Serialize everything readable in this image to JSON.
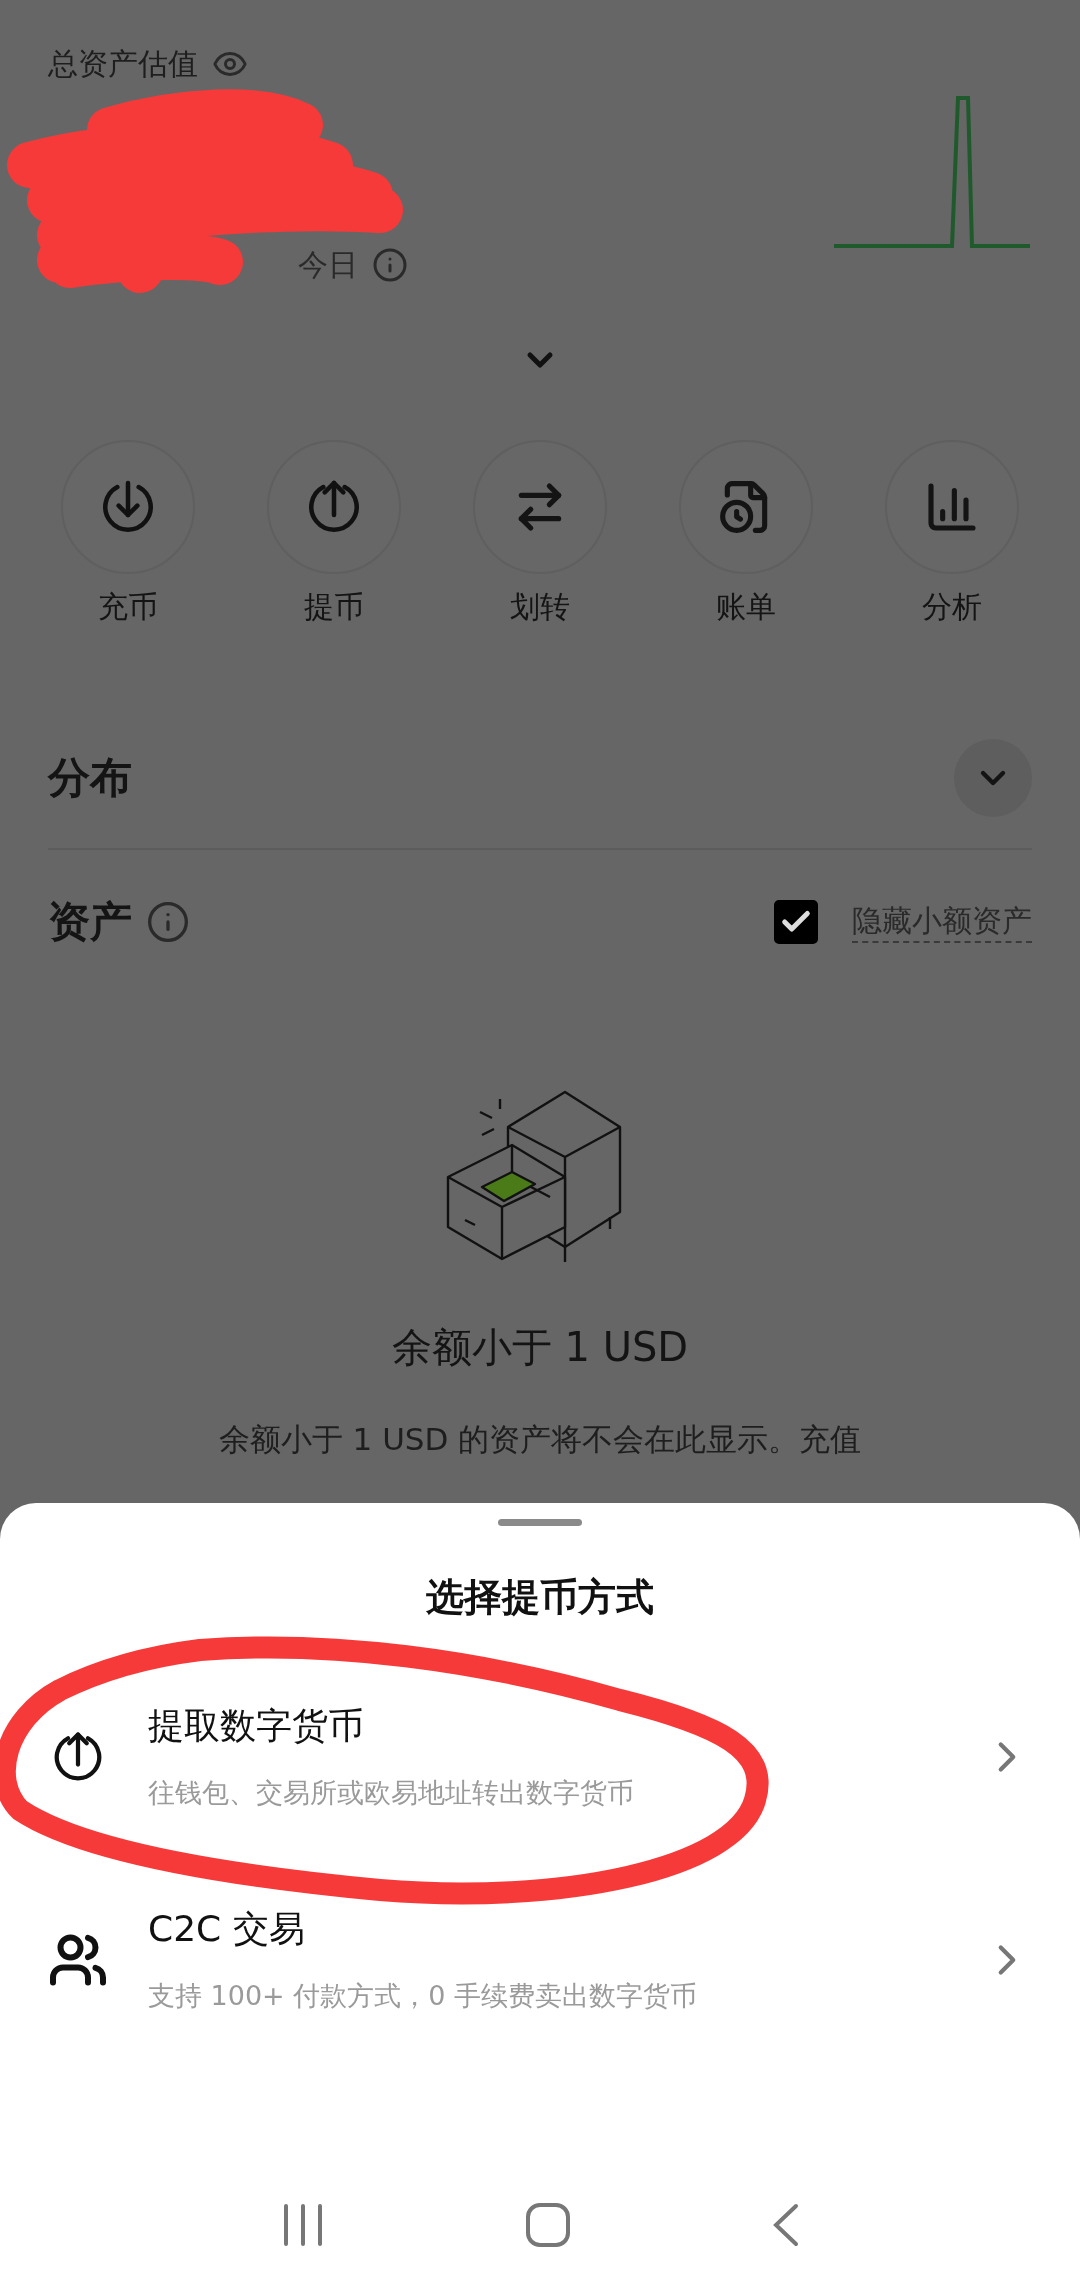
{
  "header": {
    "title": "总资产估值",
    "change_label": "今日"
  },
  "actions": [
    {
      "kind": "deposit",
      "label": "充币"
    },
    {
      "kind": "withdraw",
      "label": "提币"
    },
    {
      "kind": "transfer",
      "label": "划转"
    },
    {
      "kind": "bill",
      "label": "账单"
    },
    {
      "kind": "analysis",
      "label": "分析"
    }
  ],
  "distribution": {
    "title": "分布",
    "expanded": false
  },
  "assets": {
    "title": "资产",
    "hide_small": {
      "label": "隐藏小额资产",
      "checked": true
    }
  },
  "empty_state": {
    "title": "余额小于 1 USD",
    "lines": [
      "余额小于 1 USD 的资产将不会在此显示。充值"
    ]
  },
  "sheet": {
    "title": "选择提币方式",
    "options": [
      {
        "kind": "withdraw",
        "title": "提取数字货币",
        "subtitle": "往钱包、交易所或欧易地址转出数字货币"
      },
      {
        "kind": "c2c",
        "title": "C2C 交易",
        "subtitle": "支持 100+ 付款方式，0 手续费卖出数字货币"
      }
    ]
  }
}
